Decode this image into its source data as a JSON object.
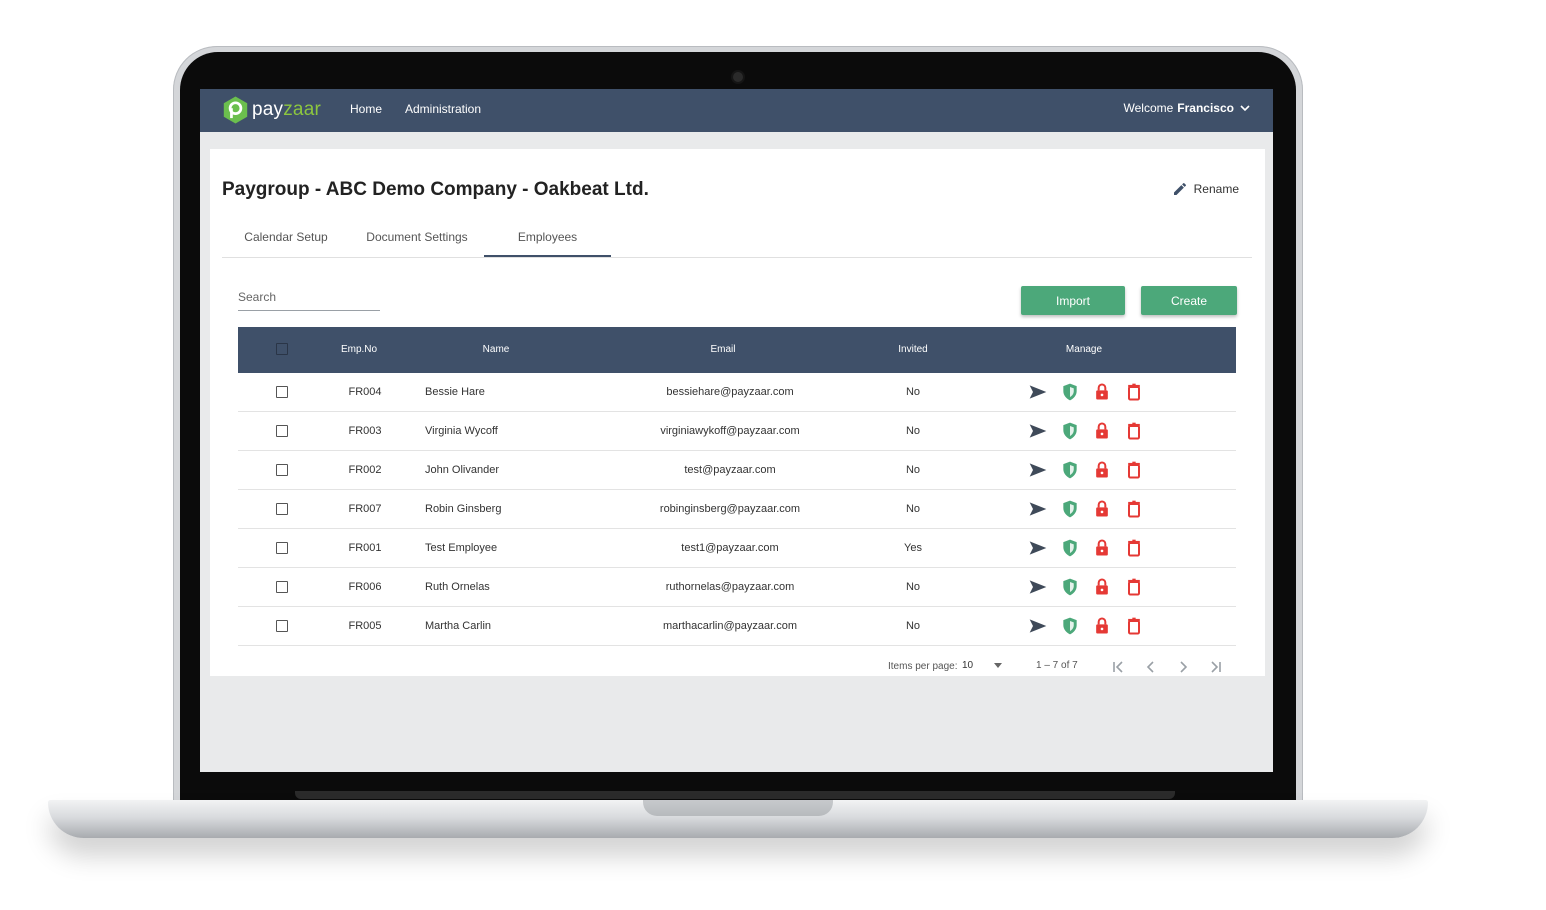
{
  "app": {
    "logo_pay": "pay",
    "logo_zaar": "zaar",
    "nav": [
      "Home",
      "Administration"
    ],
    "welcome_prefix": "Welcome",
    "welcome_user": "Francisco"
  },
  "page": {
    "title": "Paygroup - ABC Demo Company - Oakbeat Ltd.",
    "rename_label": "Rename"
  },
  "tabs": [
    {
      "label": "Calendar Setup",
      "active": false
    },
    {
      "label": "Document Settings",
      "active": false
    },
    {
      "label": "Employees",
      "active": true
    }
  ],
  "toolbar": {
    "search_placeholder": "Search",
    "import_label": "Import",
    "create_label": "Create"
  },
  "table": {
    "headers": {
      "emp_no": "Emp.No",
      "name": "Name",
      "email": "Email",
      "invited": "Invited",
      "manage": "Manage"
    },
    "rows": [
      {
        "emp_no": "FR004",
        "name": "Bessie Hare",
        "email": "bessiehare@payzaar.com",
        "invited": "No"
      },
      {
        "emp_no": "FR003",
        "name": "Virginia Wycoff",
        "email": "virginiawykoff@payzaar.com",
        "invited": "No"
      },
      {
        "emp_no": "FR002",
        "name": "John Olivander",
        "email": "test@payzaar.com",
        "invited": "No"
      },
      {
        "emp_no": "FR007",
        "name": "Robin Ginsberg",
        "email": "robinginsberg@payzaar.com",
        "invited": "No"
      },
      {
        "emp_no": "FR001",
        "name": "Test Employee",
        "email": "test1@payzaar.com",
        "invited": "Yes"
      },
      {
        "emp_no": "FR006",
        "name": "Ruth Ornelas",
        "email": "ruthornelas@payzaar.com",
        "invited": "No"
      },
      {
        "emp_no": "FR005",
        "name": "Martha Carlin",
        "email": "marthacarlin@payzaar.com",
        "invited": "No"
      }
    ]
  },
  "pagination": {
    "items_per_page_label": "Items per page:",
    "items_per_page_value": "10",
    "range_label": "1 – 7 of 7"
  },
  "icons": {
    "send": "send-icon",
    "shield": "shield-icon",
    "lock": "lock-icon",
    "delete": "trash-icon"
  },
  "colors": {
    "header_bg": "#3f5069",
    "button_green": "#4ca87a",
    "shield_green": "#4ca87a",
    "danger_red": "#e53935",
    "logo_green": "#8cc63f"
  }
}
